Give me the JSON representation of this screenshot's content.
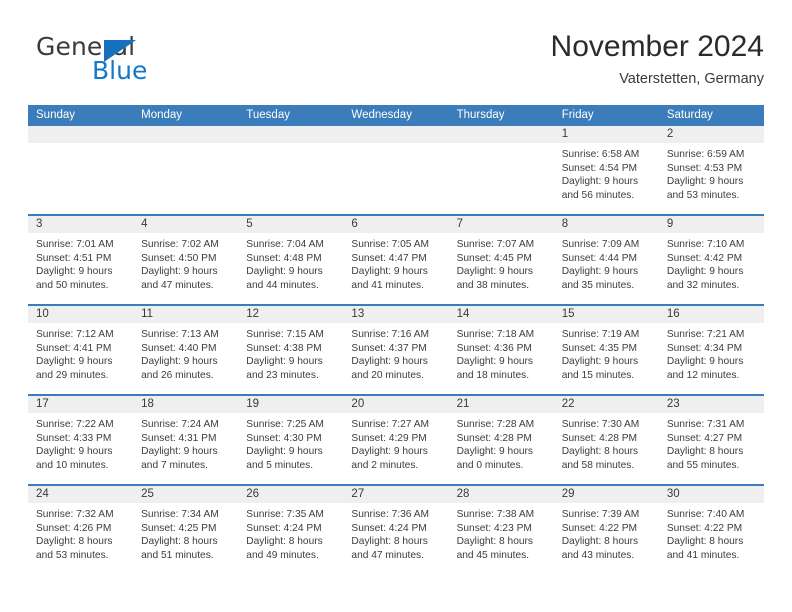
{
  "brand": {
    "name_part1": "General",
    "name_part2": "Blue",
    "triangle_icon": "triangle-icon",
    "blue": "#1478c8",
    "triangle_blue": "#1770bb"
  },
  "header": {
    "title": "November 2024",
    "subtitle": "Vaterstetten, Germany"
  },
  "colors": {
    "header_blue": "#3b7cba",
    "daynum_band": "#efefef",
    "text": "#3d3d3d"
  },
  "weekdays": [
    "Sunday",
    "Monday",
    "Tuesday",
    "Wednesday",
    "Thursday",
    "Friday",
    "Saturday"
  ],
  "weeks": [
    [
      {
        "day": "",
        "sunrise": "",
        "sunset": "",
        "daylight1": "",
        "daylight2": ""
      },
      {
        "day": "",
        "sunrise": "",
        "sunset": "",
        "daylight1": "",
        "daylight2": ""
      },
      {
        "day": "",
        "sunrise": "",
        "sunset": "",
        "daylight1": "",
        "daylight2": ""
      },
      {
        "day": "",
        "sunrise": "",
        "sunset": "",
        "daylight1": "",
        "daylight2": ""
      },
      {
        "day": "",
        "sunrise": "",
        "sunset": "",
        "daylight1": "",
        "daylight2": ""
      },
      {
        "day": "1",
        "sunrise": "Sunrise: 6:58 AM",
        "sunset": "Sunset: 4:54 PM",
        "daylight1": "Daylight: 9 hours",
        "daylight2": "and 56 minutes."
      },
      {
        "day": "2",
        "sunrise": "Sunrise: 6:59 AM",
        "sunset": "Sunset: 4:53 PM",
        "daylight1": "Daylight: 9 hours",
        "daylight2": "and 53 minutes."
      }
    ],
    [
      {
        "day": "3",
        "sunrise": "Sunrise: 7:01 AM",
        "sunset": "Sunset: 4:51 PM",
        "daylight1": "Daylight: 9 hours",
        "daylight2": "and 50 minutes."
      },
      {
        "day": "4",
        "sunrise": "Sunrise: 7:02 AM",
        "sunset": "Sunset: 4:50 PM",
        "daylight1": "Daylight: 9 hours",
        "daylight2": "and 47 minutes."
      },
      {
        "day": "5",
        "sunrise": "Sunrise: 7:04 AM",
        "sunset": "Sunset: 4:48 PM",
        "daylight1": "Daylight: 9 hours",
        "daylight2": "and 44 minutes."
      },
      {
        "day": "6",
        "sunrise": "Sunrise: 7:05 AM",
        "sunset": "Sunset: 4:47 PM",
        "daylight1": "Daylight: 9 hours",
        "daylight2": "and 41 minutes."
      },
      {
        "day": "7",
        "sunrise": "Sunrise: 7:07 AM",
        "sunset": "Sunset: 4:45 PM",
        "daylight1": "Daylight: 9 hours",
        "daylight2": "and 38 minutes."
      },
      {
        "day": "8",
        "sunrise": "Sunrise: 7:09 AM",
        "sunset": "Sunset: 4:44 PM",
        "daylight1": "Daylight: 9 hours",
        "daylight2": "and 35 minutes."
      },
      {
        "day": "9",
        "sunrise": "Sunrise: 7:10 AM",
        "sunset": "Sunset: 4:42 PM",
        "daylight1": "Daylight: 9 hours",
        "daylight2": "and 32 minutes."
      }
    ],
    [
      {
        "day": "10",
        "sunrise": "Sunrise: 7:12 AM",
        "sunset": "Sunset: 4:41 PM",
        "daylight1": "Daylight: 9 hours",
        "daylight2": "and 29 minutes."
      },
      {
        "day": "11",
        "sunrise": "Sunrise: 7:13 AM",
        "sunset": "Sunset: 4:40 PM",
        "daylight1": "Daylight: 9 hours",
        "daylight2": "and 26 minutes."
      },
      {
        "day": "12",
        "sunrise": "Sunrise: 7:15 AM",
        "sunset": "Sunset: 4:38 PM",
        "daylight1": "Daylight: 9 hours",
        "daylight2": "and 23 minutes."
      },
      {
        "day": "13",
        "sunrise": "Sunrise: 7:16 AM",
        "sunset": "Sunset: 4:37 PM",
        "daylight1": "Daylight: 9 hours",
        "daylight2": "and 20 minutes."
      },
      {
        "day": "14",
        "sunrise": "Sunrise: 7:18 AM",
        "sunset": "Sunset: 4:36 PM",
        "daylight1": "Daylight: 9 hours",
        "daylight2": "and 18 minutes."
      },
      {
        "day": "15",
        "sunrise": "Sunrise: 7:19 AM",
        "sunset": "Sunset: 4:35 PM",
        "daylight1": "Daylight: 9 hours",
        "daylight2": "and 15 minutes."
      },
      {
        "day": "16",
        "sunrise": "Sunrise: 7:21 AM",
        "sunset": "Sunset: 4:34 PM",
        "daylight1": "Daylight: 9 hours",
        "daylight2": "and 12 minutes."
      }
    ],
    [
      {
        "day": "17",
        "sunrise": "Sunrise: 7:22 AM",
        "sunset": "Sunset: 4:33 PM",
        "daylight1": "Daylight: 9 hours",
        "daylight2": "and 10 minutes."
      },
      {
        "day": "18",
        "sunrise": "Sunrise: 7:24 AM",
        "sunset": "Sunset: 4:31 PM",
        "daylight1": "Daylight: 9 hours",
        "daylight2": "and 7 minutes."
      },
      {
        "day": "19",
        "sunrise": "Sunrise: 7:25 AM",
        "sunset": "Sunset: 4:30 PM",
        "daylight1": "Daylight: 9 hours",
        "daylight2": "and 5 minutes."
      },
      {
        "day": "20",
        "sunrise": "Sunrise: 7:27 AM",
        "sunset": "Sunset: 4:29 PM",
        "daylight1": "Daylight: 9 hours",
        "daylight2": "and 2 minutes."
      },
      {
        "day": "21",
        "sunrise": "Sunrise: 7:28 AM",
        "sunset": "Sunset: 4:28 PM",
        "daylight1": "Daylight: 9 hours",
        "daylight2": "and 0 minutes."
      },
      {
        "day": "22",
        "sunrise": "Sunrise: 7:30 AM",
        "sunset": "Sunset: 4:28 PM",
        "daylight1": "Daylight: 8 hours",
        "daylight2": "and 58 minutes."
      },
      {
        "day": "23",
        "sunrise": "Sunrise: 7:31 AM",
        "sunset": "Sunset: 4:27 PM",
        "daylight1": "Daylight: 8 hours",
        "daylight2": "and 55 minutes."
      }
    ],
    [
      {
        "day": "24",
        "sunrise": "Sunrise: 7:32 AM",
        "sunset": "Sunset: 4:26 PM",
        "daylight1": "Daylight: 8 hours",
        "daylight2": "and 53 minutes."
      },
      {
        "day": "25",
        "sunrise": "Sunrise: 7:34 AM",
        "sunset": "Sunset: 4:25 PM",
        "daylight1": "Daylight: 8 hours",
        "daylight2": "and 51 minutes."
      },
      {
        "day": "26",
        "sunrise": "Sunrise: 7:35 AM",
        "sunset": "Sunset: 4:24 PM",
        "daylight1": "Daylight: 8 hours",
        "daylight2": "and 49 minutes."
      },
      {
        "day": "27",
        "sunrise": "Sunrise: 7:36 AM",
        "sunset": "Sunset: 4:24 PM",
        "daylight1": "Daylight: 8 hours",
        "daylight2": "and 47 minutes."
      },
      {
        "day": "28",
        "sunrise": "Sunrise: 7:38 AM",
        "sunset": "Sunset: 4:23 PM",
        "daylight1": "Daylight: 8 hours",
        "daylight2": "and 45 minutes."
      },
      {
        "day": "29",
        "sunrise": "Sunrise: 7:39 AM",
        "sunset": "Sunset: 4:22 PM",
        "daylight1": "Daylight: 8 hours",
        "daylight2": "and 43 minutes."
      },
      {
        "day": "30",
        "sunrise": "Sunrise: 7:40 AM",
        "sunset": "Sunset: 4:22 PM",
        "daylight1": "Daylight: 8 hours",
        "daylight2": "and 41 minutes."
      }
    ]
  ]
}
